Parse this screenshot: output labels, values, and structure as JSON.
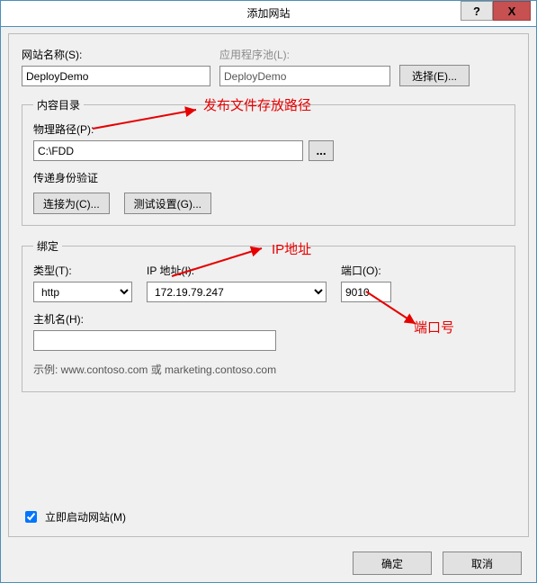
{
  "window": {
    "title": "添加网站"
  },
  "top": {
    "site_name_label": "网站名称(S):",
    "site_name_value": "DeployDemo",
    "app_pool_label": "应用程序池(L):",
    "app_pool_value": "DeployDemo",
    "select_button": "选择(E)..."
  },
  "content_dir": {
    "legend": "内容目录",
    "phys_path_label": "物理路径(P):",
    "phys_path_value": "C:\\FDD",
    "browse_button": "...",
    "passthru_label": "传递身份验证",
    "connect_as_button": "连接为(C)...",
    "test_settings_button": "测试设置(G)..."
  },
  "binding": {
    "legend": "绑定",
    "type_label": "类型(T):",
    "type_value": "http",
    "ip_label": "IP 地址(I):",
    "ip_value": "172.19.79.247",
    "port_label": "端口(O):",
    "port_value": "9010",
    "host_label": "主机名(H):",
    "host_value": "",
    "example": "示例: www.contoso.com 或 marketing.contoso.com"
  },
  "start_immediately_label": "立即启动网站(M)",
  "footer": {
    "ok": "确定",
    "cancel": "取消"
  },
  "annotations": {
    "publish_path": "发布文件存放路径",
    "ip": "IP地址",
    "port": "端口号"
  }
}
